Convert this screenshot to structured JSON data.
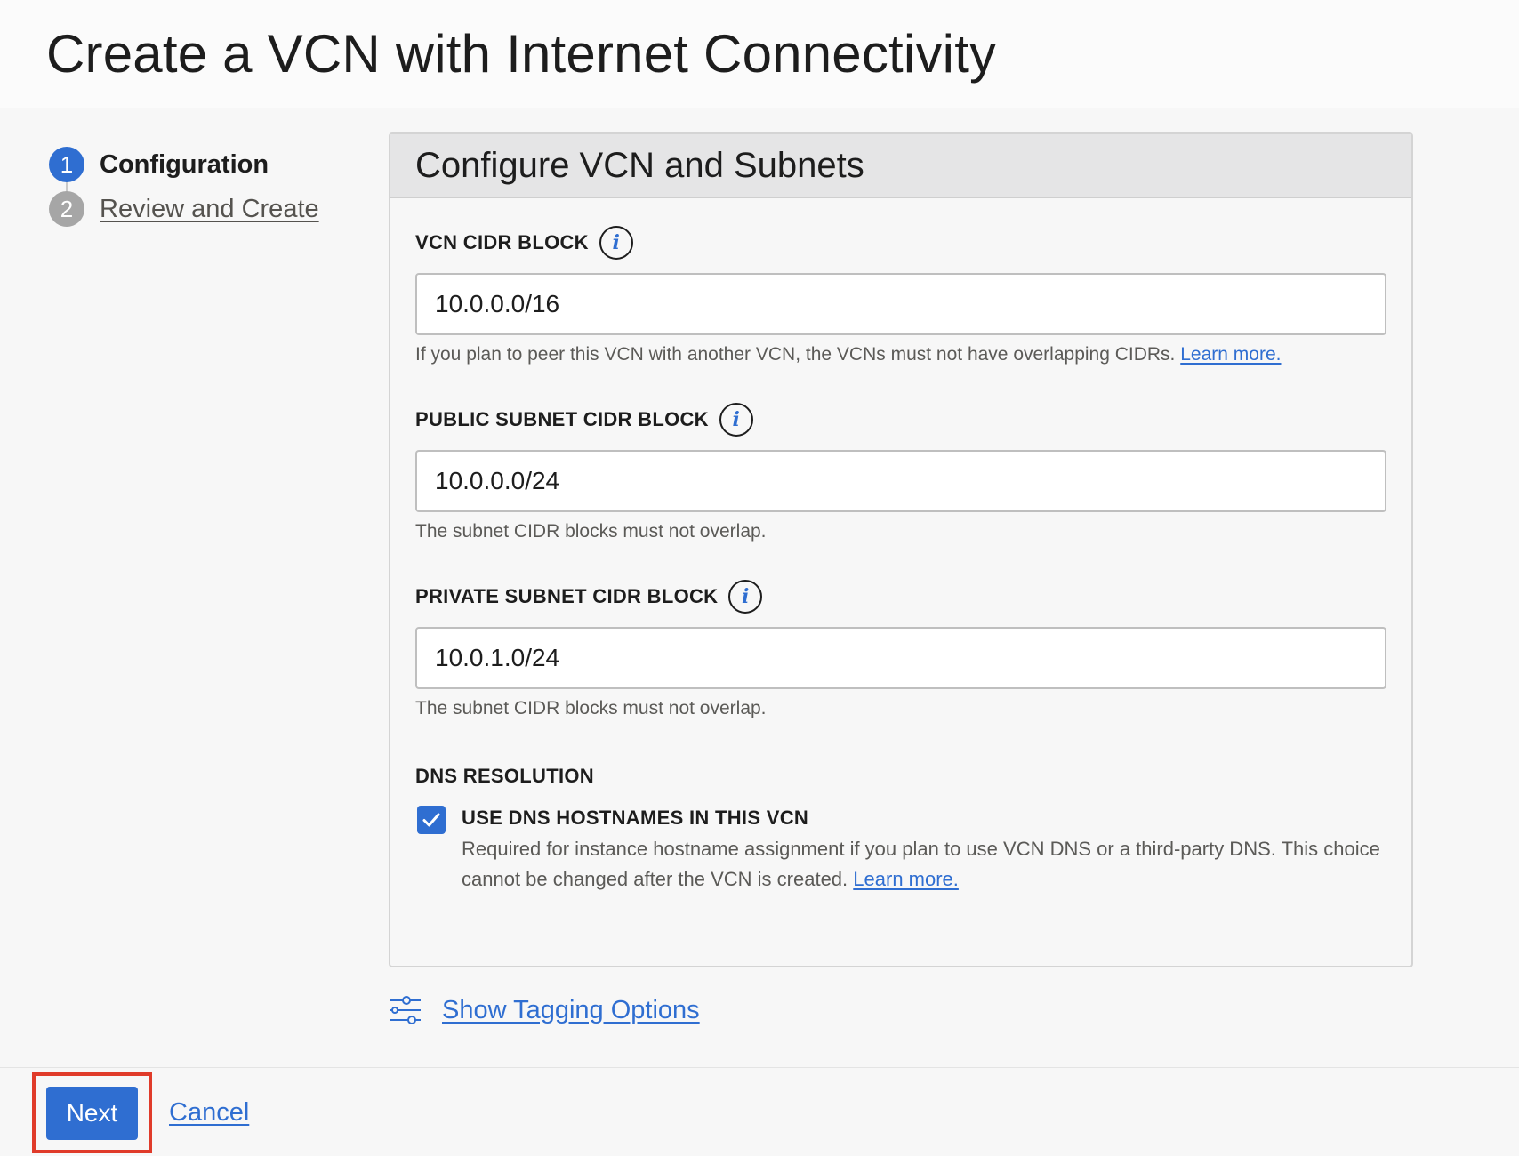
{
  "header": {
    "title": "Create a VCN with Internet Connectivity"
  },
  "steps": [
    {
      "number": "1",
      "label": "Configuration",
      "state": "active"
    },
    {
      "number": "2",
      "label": "Review and Create",
      "state": "inactive"
    }
  ],
  "panel": {
    "title": "Configure VCN and Subnets",
    "vcn_cidr": {
      "label": "VCN CIDR BLOCK",
      "value": "10.0.0.0/16",
      "help": "If you plan to peer this VCN with another VCN, the VCNs must not have overlapping CIDRs.",
      "link": "Learn more."
    },
    "public_subnet": {
      "label": "PUBLIC SUBNET CIDR BLOCK",
      "value": "10.0.0.0/24",
      "help": "The subnet CIDR blocks must not overlap."
    },
    "private_subnet": {
      "label": "PRIVATE SUBNET CIDR BLOCK",
      "value": "10.0.1.0/24",
      "help": "The subnet CIDR blocks must not overlap."
    },
    "dns": {
      "section_label": "DNS RESOLUTION",
      "checkbox_label": "USE DNS HOSTNAMES IN THIS VCN",
      "checked": true,
      "desc": "Required for instance hostname assignment if you plan to use VCN DNS or a third-party DNS. This choice cannot be changed after the VCN is created.",
      "link": "Learn more."
    },
    "info_icon_glyph": "i"
  },
  "tagging": {
    "label": "Show Tagging Options",
    "icon": "sliders-icon"
  },
  "footer": {
    "next_label": "Next",
    "cancel_label": "Cancel"
  },
  "colors": {
    "accent": "#2f6ed1",
    "highlight": "#e03b2a"
  }
}
